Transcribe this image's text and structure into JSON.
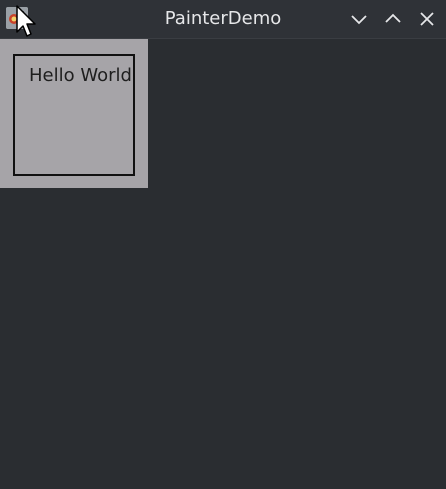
{
  "window": {
    "title": "PainterDemo"
  },
  "titlebar_buttons": {
    "minimize_icon": "chevron-down-icon",
    "maximize_icon": "chevron-up-icon",
    "close_icon": "close-icon"
  },
  "canvas": {
    "text": "Hello World",
    "background": "#a6a4a8",
    "border_color": "#111111"
  },
  "colors": {
    "window_background": "#2a2d31",
    "titlebar_background": "#2f3237",
    "title_text": "#e6e7e9"
  }
}
